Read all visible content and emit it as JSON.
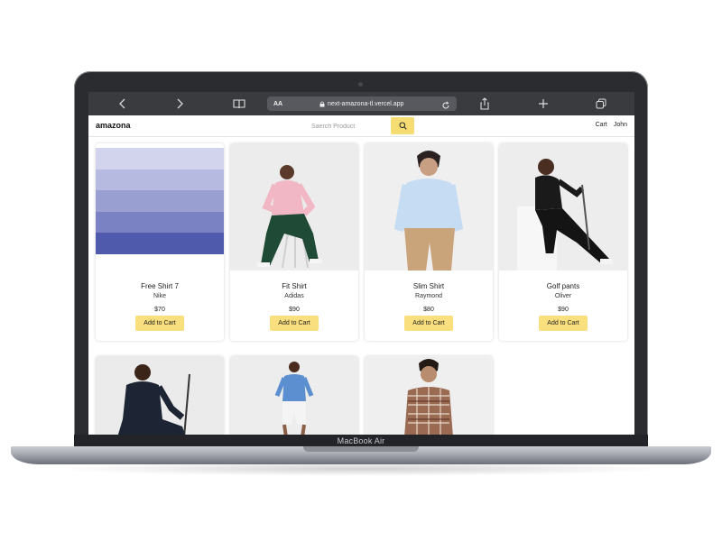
{
  "device": {
    "label": "MacBook Air"
  },
  "browser": {
    "url": "next-amazona-tl.vercel.app",
    "text_size_button": "AA",
    "icons": [
      "back-icon",
      "forward-icon",
      "bookmarks-icon",
      "lock-icon",
      "reload-icon",
      "share-icon",
      "new-tab-icon",
      "tabs-icon"
    ]
  },
  "header": {
    "brand": "amazona",
    "search_placeholder": "Saerch Product",
    "cart_label": "Cart",
    "user_label": "John"
  },
  "colors": {
    "accent": "#f6dd73",
    "button": "#f9df7d"
  },
  "products": [
    {
      "name": "Free Shirt 7",
      "brand": "Nike",
      "price": "$70",
      "button": "Add to Cart"
    },
    {
      "name": "Fit Shirt",
      "brand": "Adidas",
      "price": "$90",
      "button": "Add to Cart"
    },
    {
      "name": "Slim Shirt",
      "brand": "Raymond",
      "price": "$80",
      "button": "Add to Cart"
    },
    {
      "name": "Golf pants",
      "brand": "Oliver",
      "price": "$90",
      "button": "Add to Cart"
    }
  ]
}
